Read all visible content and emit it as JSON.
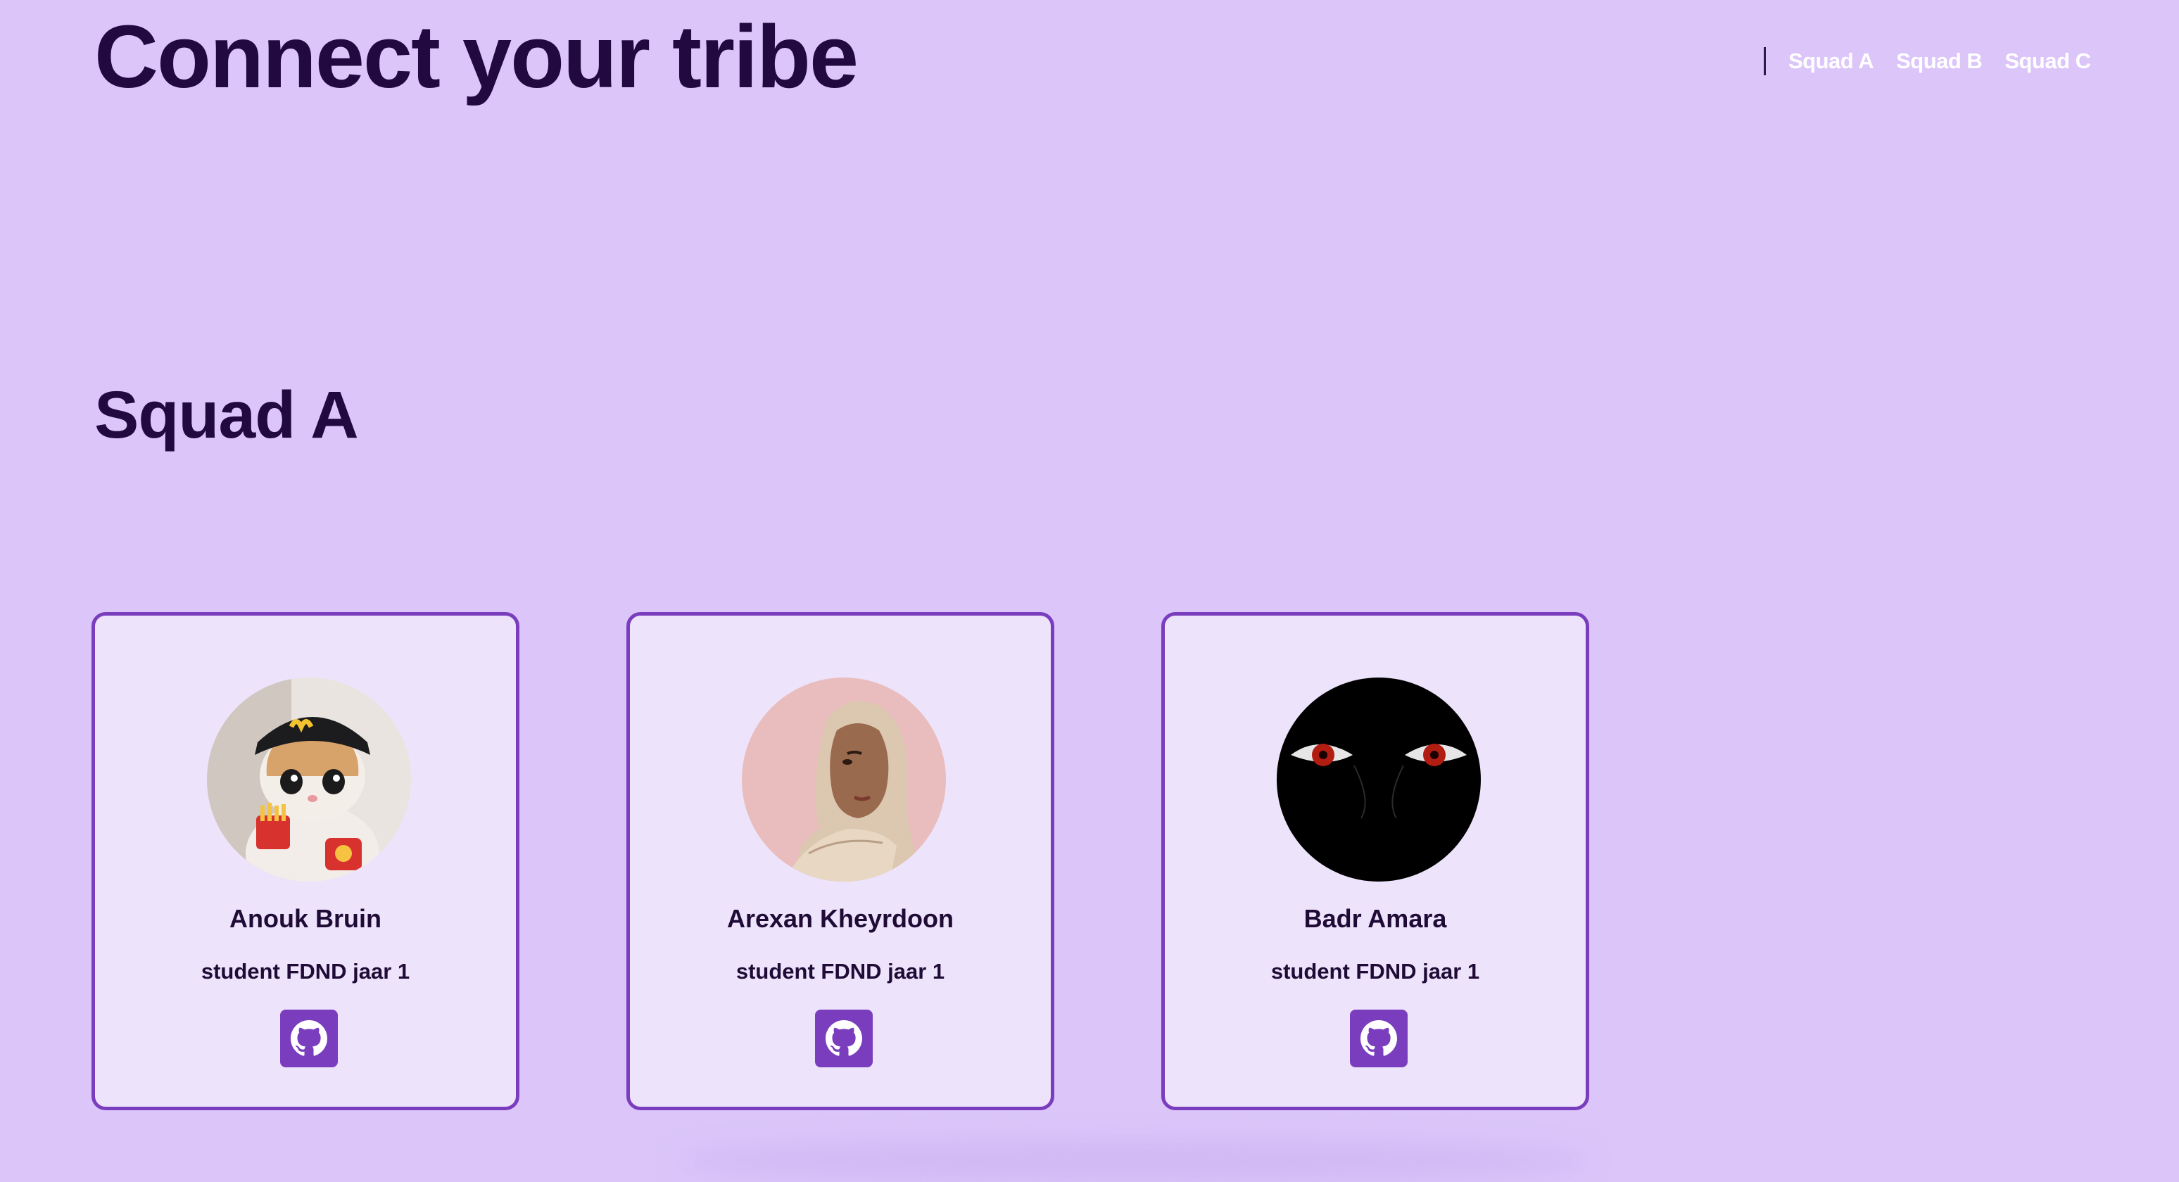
{
  "header": {
    "title": "Connect your tribe"
  },
  "nav": {
    "links": [
      {
        "label": "Squad A"
      },
      {
        "label": "Squad B"
      },
      {
        "label": "Squad C"
      }
    ]
  },
  "section": {
    "title": "Squad A"
  },
  "members": [
    {
      "name": "Anouk Bruin",
      "role": "student FDND jaar 1",
      "avatar": "kitten-with-cap-avatar",
      "link_icon": "github-icon"
    },
    {
      "name": "Arexan Kheyrdoon",
      "role": "student FDND jaar 1",
      "avatar": "illustrated-woman-hijab-avatar",
      "link_icon": "github-icon"
    },
    {
      "name": "Badr Amara",
      "role": "student FDND jaar 1",
      "avatar": "red-eyes-dark-avatar",
      "link_icon": "github-icon"
    }
  ],
  "colors": {
    "background": "#dbc5f9",
    "card_background": "#ede3fb",
    "accent": "#7a3dbd",
    "heading": "#22093f",
    "nav_text": "#ffffff"
  }
}
